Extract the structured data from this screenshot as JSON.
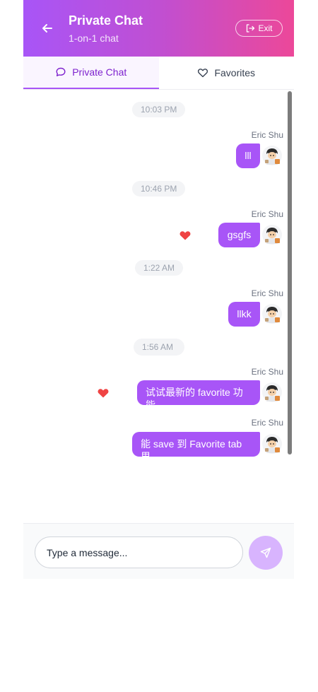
{
  "header": {
    "title": "Private Chat",
    "subtitle": "1-on-1 chat",
    "exit_label": "Exit"
  },
  "tabs": [
    {
      "label": "Private Chat",
      "icon": "chat-bubble-icon",
      "active": true
    },
    {
      "label": "Favorites",
      "icon": "heart-outline-icon",
      "active": false
    }
  ],
  "messages": [
    {
      "time": "10:03 PM",
      "sender": "Eric Shu",
      "text": "lll",
      "favorited": false
    },
    {
      "time": "10:46 PM",
      "sender": "Eric Shu",
      "text": "gsgfs",
      "favorited": true
    },
    {
      "time": "1:22 AM",
      "sender": "Eric Shu",
      "text": "llkk",
      "favorited": false
    },
    {
      "time": "1:56 AM",
      "sender": "Eric Shu",
      "text": "试试最新的 favorite 功能",
      "favorited": true
    },
    {
      "time": "",
      "sender": "Eric Shu",
      "text": "能 save 到 Favorite tab 里",
      "favorited": false
    }
  ],
  "composer": {
    "placeholder": "Type a message..."
  },
  "colors": {
    "accent": "#a855f7",
    "gradient_end": "#ec4899",
    "heart": "#ef4444"
  }
}
